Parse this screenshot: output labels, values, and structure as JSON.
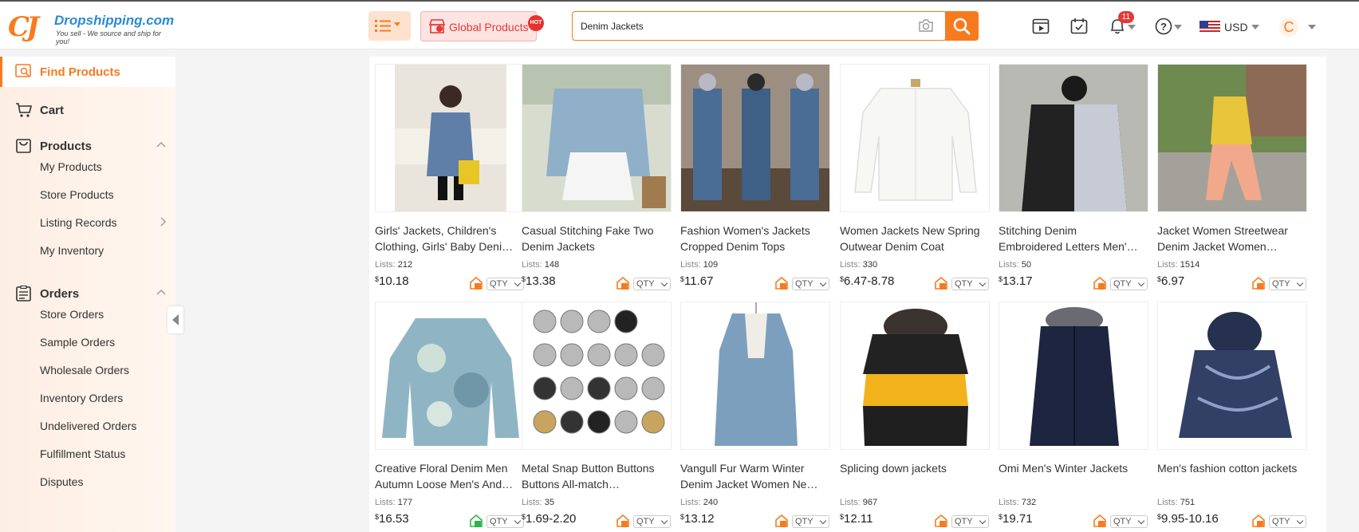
{
  "header": {
    "logo": {
      "name": "Dropshipping.com",
      "tagline": "You sell - We source and ship for you!",
      "mark": "CJ"
    },
    "global_products_label": "Global Products",
    "hot_badge": "HOT",
    "search": {
      "value": "Denim Jackets"
    },
    "notifications_count": "11",
    "currency": "USD",
    "avatar_initial": "C"
  },
  "sidebar": {
    "find_products": "Find Products",
    "cart": "Cart",
    "products": {
      "label": "Products",
      "items": [
        "My Products",
        "Store Products",
        "Listing Records",
        "My Inventory"
      ]
    },
    "orders": {
      "label": "Orders",
      "items": [
        "Store Orders",
        "Sample Orders",
        "Wholesale Orders",
        "Inventory Orders",
        "Undelivered Orders",
        "Fulfillment Status",
        "Disputes"
      ]
    }
  },
  "colors": {
    "accent": "#f77b1e",
    "hot": "#e53935",
    "link": "#2a8ad6"
  },
  "products": [
    {
      "title1": "Girls' Jackets, Children's",
      "title2": "Clothing, Girls' Baby Deni…",
      "lists_label": "Lists:",
      "lists": "212",
      "currency": "$",
      "price": "10.18",
      "qty": "QTY",
      "ship": "orange"
    },
    {
      "title1": "Casual Stitching Fake Two",
      "title2": "Denim Jackets",
      "lists_label": "Lists:",
      "lists": "148",
      "currency": "$",
      "price": "13.38",
      "qty": "QTY",
      "ship": "orange"
    },
    {
      "title1": "Fashion Women's Jackets",
      "title2": "Cropped Denim Tops",
      "lists_label": "Lists:",
      "lists": "109",
      "currency": "$",
      "price": "11.67",
      "qty": "QTY",
      "ship": "orange"
    },
    {
      "title1": "Women Jackets New Spring",
      "title2": "Outwear Denim Coat",
      "lists_label": "Lists:",
      "lists": "330",
      "currency": "$",
      "price": "6.47-8.78",
      "qty": "QTY",
      "ship": "orange"
    },
    {
      "title1": "Stitching Denim",
      "title2": "Embroidered Letters Men'…",
      "lists_label": "Lists:",
      "lists": "50",
      "currency": "$",
      "price": "13.17",
      "qty": "QTY",
      "ship": "orange"
    },
    {
      "title1": "Jacket Women Streetwear",
      "title2": "Denim Jacket Women…",
      "lists_label": "Lists:",
      "lists": "1514",
      "currency": "$",
      "price": "6.97",
      "qty": "QTY",
      "ship": "orange"
    },
    {
      "title1": "Creative Floral Denim Men",
      "title2": "Autumn Loose Men's And…",
      "lists_label": "Lists:",
      "lists": "177",
      "currency": "$",
      "price": "16.53",
      "qty": "QTY",
      "ship": "green"
    },
    {
      "title1": "Metal Snap Button Buttons",
      "title2": "Buttons All-match…",
      "lists_label": "Lists:",
      "lists": "35",
      "currency": "$",
      "price": "1.69-2.20",
      "qty": "QTY",
      "ship": "orange"
    },
    {
      "title1": "Vangull Fur Warm Winter",
      "title2": "Denim Jacket Women Ne…",
      "lists_label": "Lists:",
      "lists": "240",
      "currency": "$",
      "price": "13.12",
      "qty": "QTY",
      "ship": "orange"
    },
    {
      "title1": "Splicing down jackets",
      "title2": "",
      "lists_label": "Lists:",
      "lists": "967",
      "currency": "$",
      "price": "12.11",
      "qty": "QTY",
      "ship": "orange"
    },
    {
      "title1": "Omi Men's Winter Jackets",
      "title2": "",
      "lists_label": "Lists:",
      "lists": "732",
      "currency": "$",
      "price": "19.71",
      "qty": "QTY",
      "ship": "orange"
    },
    {
      "title1": "Men's fashion cotton jackets",
      "title2": "",
      "lists_label": "Lists:",
      "lists": "751",
      "currency": "$",
      "price": "9.95-10.16",
      "qty": "QTY",
      "ship": "orange"
    }
  ]
}
